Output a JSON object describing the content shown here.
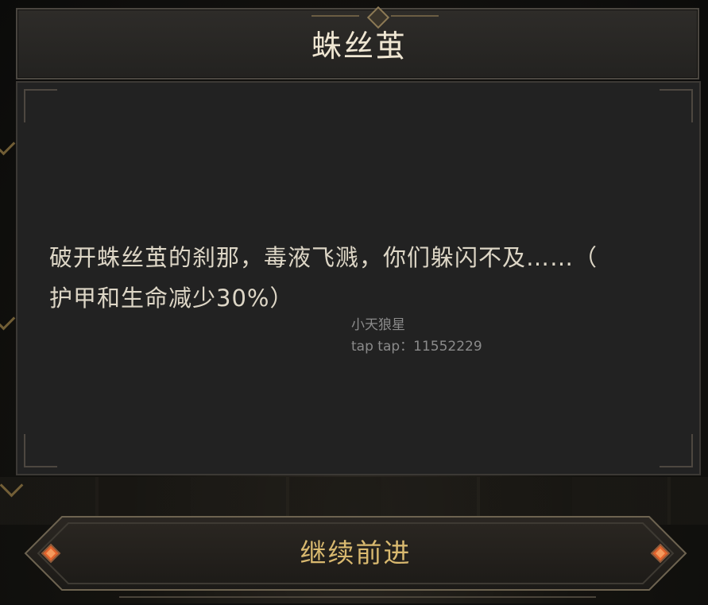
{
  "dialog": {
    "title": "蛛丝茧",
    "story_line1": "破开蛛丝茧的刹那，毒液飞溅，你们躲闪不及……（",
    "story_line2": "护甲和生命减少30%）"
  },
  "watermark": {
    "line1": "小天狼星",
    "line2": "tap tap：11552229"
  },
  "continue_button": {
    "label": "继续前进"
  },
  "colors": {
    "panel": "#222222",
    "title_text": "#efe6d2",
    "story_text": "#ddd6c6",
    "button_text": "#d9b96f",
    "gem": "#e0622c"
  }
}
